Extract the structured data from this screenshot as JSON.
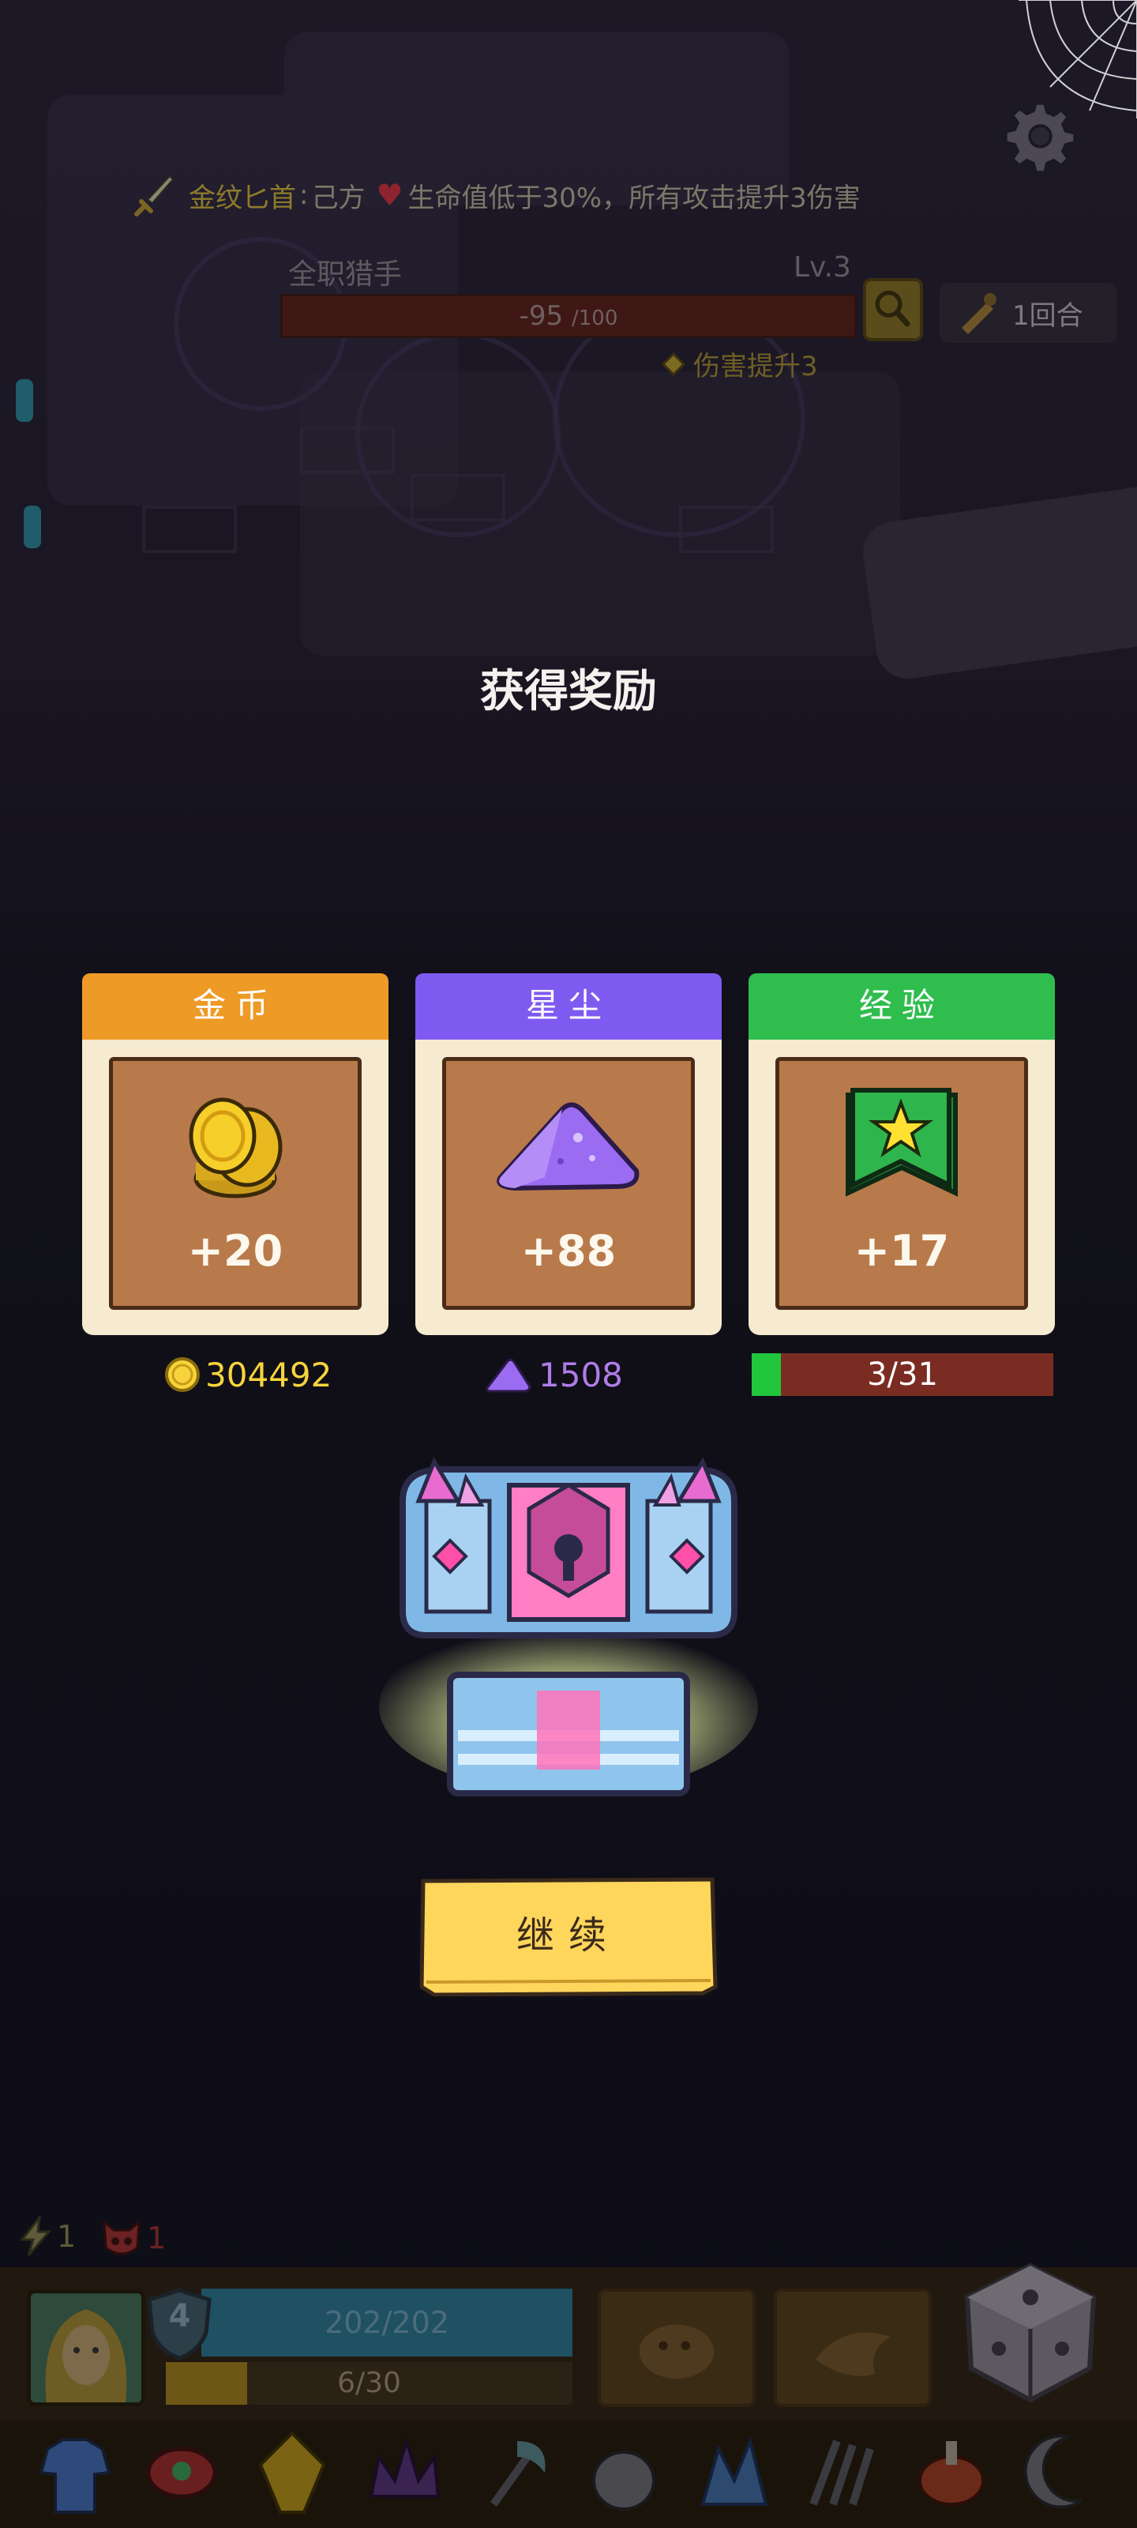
{
  "hud": {
    "buff_item_name": "金纹匕首",
    "buff_separator": ":",
    "buff_target": "己方",
    "buff_effect": "生命值低于30%，所有攻击提升3伤害",
    "enemy_name": "全职猎手",
    "enemy_level": "Lv.3",
    "enemy_hp_current": "-95",
    "enemy_hp_max": "/100",
    "round_label": "1回合",
    "damage_buff": "伤害提升3"
  },
  "reward": {
    "title": "获得奖励",
    "cards": [
      {
        "label": "金币",
        "amount": "+20",
        "icon": "gold-coins-icon",
        "color": "#ee9a26"
      },
      {
        "label": "星尘",
        "amount": "+88",
        "icon": "stardust-pile-icon",
        "color": "#7f5af0"
      },
      {
        "label": "经验",
        "amount": "+17",
        "icon": "star-banner-icon",
        "color": "#2fbd4e"
      }
    ],
    "gold_total": "304492",
    "stardust_total": "1508",
    "exp_progress_text": "3/31",
    "exp_progress_fraction": 0.097,
    "continue_label": "继续"
  },
  "player": {
    "energy": "1",
    "threat": "1",
    "level": "4",
    "hp_text": "202/202",
    "xp_text": "6/30",
    "xp_fraction": 0.2
  }
}
